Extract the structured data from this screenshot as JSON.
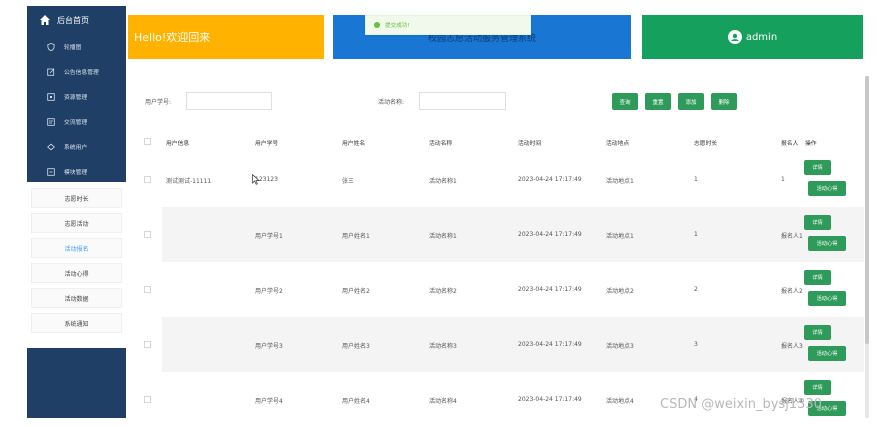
{
  "sidebar": {
    "header": "后台首页",
    "items": [
      {
        "label": "轮播图",
        "icon": "shield-icon"
      },
      {
        "label": "公告信息管理",
        "icon": "edit-icon"
      },
      {
        "label": "资源管理",
        "icon": "folder-icon"
      },
      {
        "label": "交流管理",
        "icon": "chat-icon"
      },
      {
        "label": "系统用户",
        "icon": "user-icon"
      },
      {
        "label": "模块管理",
        "icon": "module-icon"
      }
    ],
    "submenu": [
      {
        "label": "志愿时长",
        "active": false
      },
      {
        "label": "志愿活动",
        "active": false
      },
      {
        "label": "活动报名",
        "active": true
      },
      {
        "label": "活动心得",
        "active": false
      },
      {
        "label": "活动数据",
        "active": false
      },
      {
        "label": "系统通知",
        "active": false
      }
    ]
  },
  "cards": {
    "welcome": "Hello!欢迎回来",
    "system_title": "校园志愿活动服务管理系统",
    "user": "admin"
  },
  "toast": {
    "text": "提交成功!"
  },
  "filters": {
    "field1_label": "用户学号:",
    "field1_value": "",
    "field2_label": "活动名称:",
    "field2_value": "",
    "buttons": [
      "查询",
      "重置",
      "添加",
      "删除"
    ]
  },
  "table": {
    "headers": [
      "用户信息",
      "用户学号",
      "用户姓名",
      "活动名称",
      "活动时间",
      "活动地点",
      "志愿时长",
      "报名人",
      "操作"
    ],
    "rows": [
      [
        "测试测试-11111",
        "123123",
        "张三",
        "活动名称1",
        "2023-04-24 17:17:49",
        "活动地点1",
        "1",
        "1"
      ],
      [
        "",
        "用户学号1",
        "用户姓名1",
        "活动名称1",
        "2023-04-24 17:17:49",
        "活动地点1",
        "1",
        "报名人1"
      ],
      [
        "",
        "用户学号2",
        "用户姓名2",
        "活动名称2",
        "2023-04-24 17:17:49",
        "活动地点2",
        "2",
        "报名人2"
      ],
      [
        "",
        "用户学号3",
        "用户姓名3",
        "活动名称3",
        "2023-04-24 17:17:49",
        "活动地点3",
        "3",
        "报名人3"
      ],
      [
        "",
        "用户学号4",
        "用户姓名4",
        "活动名称4",
        "2023-04-24 17:17:49",
        "活动地点4",
        "4",
        "报名人4"
      ]
    ],
    "row_actions": [
      "详情",
      "活动心得"
    ]
  },
  "watermark": "CSDN @weixin_bysj1330",
  "colors": {
    "sidebar": "#1f3f66",
    "yellow": "#ffb300",
    "blue": "#1976d2",
    "green": "#16a05d",
    "button": "#2f9b5a",
    "active": "#409eff"
  }
}
